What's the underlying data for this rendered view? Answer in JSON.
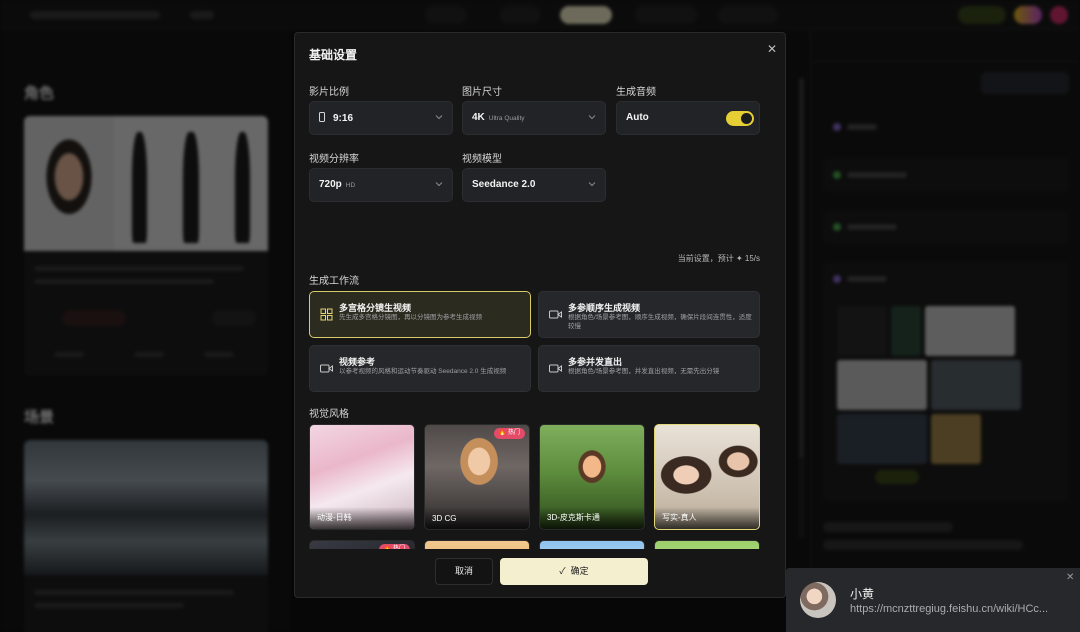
{
  "modal": {
    "title": "基础设置",
    "fields": {
      "aspect_ratio": {
        "label": "影片比例",
        "value": "9:16"
      },
      "image_size": {
        "label": "图片尺寸",
        "value": "4K",
        "sub": "Ultra Quality"
      },
      "audio": {
        "label": "生成音频",
        "value": "Auto",
        "enabled": true
      },
      "resolution": {
        "label": "视频分辨率",
        "value": "720p",
        "sub": "HD"
      },
      "video_model": {
        "label": "视频模型",
        "value": "Seedance 2.0"
      }
    },
    "estimate": "当前设置，预计 ✦ 15/s",
    "workflow": {
      "label": "生成工作流",
      "options": [
        {
          "title": "多宫格分镜生视频",
          "desc": "先生成多宫格分镜图，再以分镜图为参考生成视频",
          "selected": true,
          "icon": "grid-icon"
        },
        {
          "title": "多参顺序生成视频",
          "desc": "根据角色/场景参考图，顺序生成视频，确保片段间连贯性，适度较慢",
          "selected": false,
          "icon": "video-icon"
        },
        {
          "title": "视频参考",
          "desc": "以参考视频的风格和运动节奏驱动 Seedance 2.0 生成视频",
          "selected": false,
          "icon": "video-icon"
        },
        {
          "title": "多参并发直出",
          "desc": "根据角色/场景参考图，并发直出视频，无需先出分镜",
          "selected": false,
          "icon": "video-icon"
        }
      ]
    },
    "style": {
      "label": "视觉风格",
      "items": [
        {
          "name": "动漫-日韩",
          "badge": "",
          "selected": false
        },
        {
          "name": "3D CG",
          "badge": "热门",
          "selected": false
        },
        {
          "name": "3D-皮克斯卡通",
          "badge": "",
          "selected": false
        },
        {
          "name": "写实-真人",
          "badge": "",
          "selected": true
        },
        {
          "name": "",
          "badge": "热门",
          "selected": false
        },
        {
          "name": "",
          "badge": "",
          "selected": false
        },
        {
          "name": "",
          "badge": "",
          "selected": false
        },
        {
          "name": "",
          "badge": "",
          "selected": false
        }
      ]
    },
    "buttons": {
      "cancel": "取消",
      "confirm": "确定"
    }
  },
  "background": {
    "section_characters": "角色",
    "section_scenes": "场景"
  },
  "toast": {
    "sender": "小黄",
    "message": "https://mcnzttregiug.feishu.cn/wiki/HCc..."
  },
  "colors": {
    "accent": "#e6cf34",
    "confirm_bg": "#f4efcf",
    "badge": "#e34b66"
  }
}
